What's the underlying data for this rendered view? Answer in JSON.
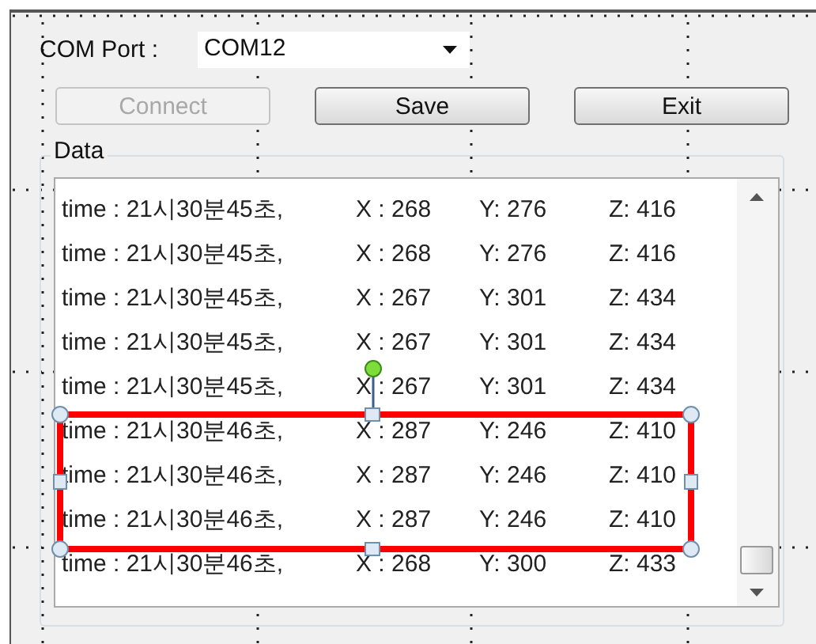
{
  "com_port": {
    "label": "COM Port :",
    "value": "COM12"
  },
  "buttons": [
    {
      "label": "Connect",
      "disabled": true
    },
    {
      "label": "Save",
      "disabled": false
    },
    {
      "label": "Exit",
      "disabled": false
    }
  ],
  "data_group": {
    "label": "Data",
    "rows": [
      {
        "time": "time : 21시30분45초,",
        "x": "X : 268",
        "y": "Y: 276",
        "z": "Z: 416"
      },
      {
        "time": "time : 21시30분45초,",
        "x": "X : 268",
        "y": "Y: 276",
        "z": "Z: 416"
      },
      {
        "time": "time : 21시30분45초,",
        "x": "X : 267",
        "y": "Y: 301",
        "z": "Z: 434"
      },
      {
        "time": "time : 21시30분45초,",
        "x": "X : 267",
        "y": "Y: 301",
        "z": "Z: 434"
      },
      {
        "time": "time : 21시30분45초,",
        "x": "X : 267",
        "y": "Y: 301",
        "z": "Z: 434"
      },
      {
        "time": "time : 21시30분46초,",
        "x": "X : 287",
        "y": "Y: 246",
        "z": "Z: 410"
      },
      {
        "time": "time : 21시30분46초,",
        "x": "X : 287",
        "y": "Y: 246",
        "z": "Z: 410"
      },
      {
        "time": "time : 21시30분46초,",
        "x": "X : 287",
        "y": "Y: 246",
        "z": "Z: 410"
      },
      {
        "time": "time : 21시30분46초,",
        "x": "X : 268",
        "y": "Y: 300",
        "z": "Z: 433"
      }
    ]
  }
}
